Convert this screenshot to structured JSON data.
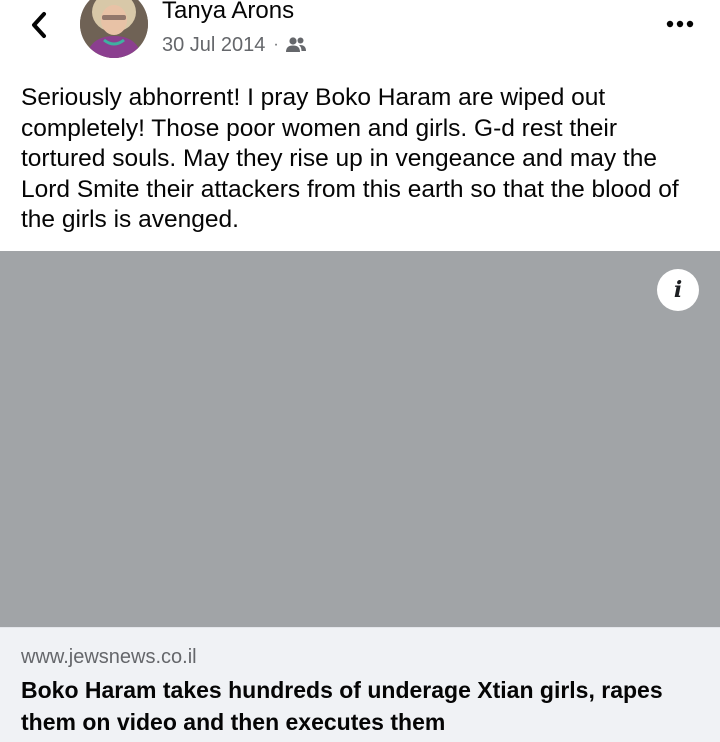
{
  "post": {
    "author": "Tanya Arons",
    "date": "30 Jul 2014",
    "separator": "·",
    "audience_icon": "friends-icon",
    "text": "Seriously abhorrent!  I pray Boko Haram are wiped out completely!  Those poor women and girls.  G-d rest their tortured souls.  May they rise up in vengeance and may the Lord Smite their attackers from this earth so that the blood of the girls is avenged."
  },
  "icons": {
    "back": "chevron-left-icon",
    "more": "more-horizontal-icon",
    "info": "info-icon"
  },
  "link": {
    "info_glyph": "i",
    "domain": "www.jewsnews.co.il",
    "title": "Boko Haram takes hundreds of underage Xtian girls, rapes them on video and then executes them"
  },
  "colors": {
    "image_placeholder": "#a1a4a7",
    "footer_bg": "#f0f2f5",
    "secondary_text": "#65676b"
  }
}
